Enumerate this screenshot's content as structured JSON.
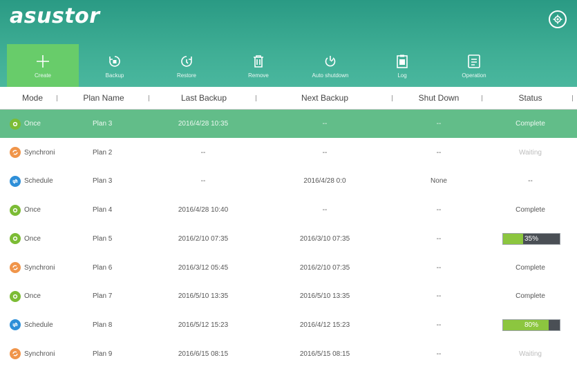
{
  "app": {
    "logo": "asustor"
  },
  "colors": {
    "once": "#7cbc35",
    "synchroni": "#f0954a",
    "schedule": "#2e8fd8"
  },
  "toolbar": [
    {
      "label": "Create",
      "icon": "plus-icon"
    },
    {
      "label": "Backup",
      "icon": "backup-icon"
    },
    {
      "label": "Restore",
      "icon": "restore-icon"
    },
    {
      "label": "Remove",
      "icon": "trash-icon"
    },
    {
      "label": "Auto shutdown",
      "icon": "power-icon"
    },
    {
      "label": "Log",
      "icon": "log-icon"
    },
    {
      "label": "Operation",
      "icon": "operation-icon"
    }
  ],
  "columns": [
    "Mode",
    "Plan Name",
    "Last Backup",
    "Next Backup",
    "Shut Down",
    "Status"
  ],
  "rows": [
    {
      "mode": "Once",
      "plan": "Plan 3",
      "last": "2016/4/28 10:35",
      "next": "--",
      "shut": "--",
      "status": "Complete"
    },
    {
      "mode": "Synchroni",
      "plan": "Plan 2",
      "last": "--",
      "next": "--",
      "shut": "--",
      "status": "Waiting"
    },
    {
      "mode": "Schedule",
      "plan": "Plan 3",
      "last": "--",
      "next": "2016/4/28 0:0",
      "shut": "None",
      "status": "--"
    },
    {
      "mode": "Once",
      "plan": "Plan 4",
      "last": "2016/4/28 10:40",
      "next": "--",
      "shut": "--",
      "status": "Complete"
    },
    {
      "mode": "Once",
      "plan": "Plan 5",
      "last": "2016/2/10 07:35",
      "next": "2016/3/10 07:35",
      "shut": "--",
      "status": "35%",
      "progress": 0.35
    },
    {
      "mode": "Synchroni",
      "plan": "Plan 6",
      "last": "2016/3/12  05:45",
      "next": "2016/2/10 07:35",
      "shut": "--",
      "status": "Complete"
    },
    {
      "mode": "Once",
      "plan": "Plan 7",
      "last": "2016/5/10 13:35",
      "next": "2016/5/10 13:35",
      "shut": "--",
      "status": "Complete"
    },
    {
      "mode": "Schedule",
      "plan": "Plan 8",
      "last": "2016/5/12 15:23",
      "next": "2016/4/12 15:23",
      "shut": "--",
      "status": "80%",
      "progress": 0.8
    },
    {
      "mode": "Synchroni",
      "plan": "Plan 9",
      "last": "2016/6/15  08:15",
      "next": "2016/5/15 08:15",
      "shut": "--",
      "status": "Waiting"
    }
  ]
}
